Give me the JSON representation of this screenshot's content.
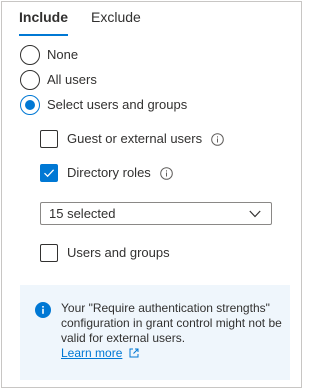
{
  "tabs": [
    {
      "label": "Include",
      "active": true
    },
    {
      "label": "Exclude",
      "active": false
    }
  ],
  "radios": [
    {
      "label": "None",
      "checked": false
    },
    {
      "label": "All users",
      "checked": false
    },
    {
      "label": "Select users and groups",
      "checked": true
    }
  ],
  "options": {
    "guest": {
      "label": "Guest or external users",
      "checked": false
    },
    "directory_roles": {
      "label": "Directory roles",
      "checked": true
    },
    "roles_dropdown": {
      "value": "15 selected"
    },
    "users_groups": {
      "label": "Users and groups",
      "checked": false
    }
  },
  "info": {
    "message": "Your \"Require authentication strengths\" configuration in grant control might not be valid for external users.",
    "link_label": "Learn more"
  },
  "colors": {
    "accent": "#0078d4",
    "info_background": "#eff6fc",
    "border": "#c8c6c4"
  },
  "icons": [
    "info-icon",
    "chevron-down-icon",
    "checkmark-icon",
    "external-link-icon"
  ]
}
